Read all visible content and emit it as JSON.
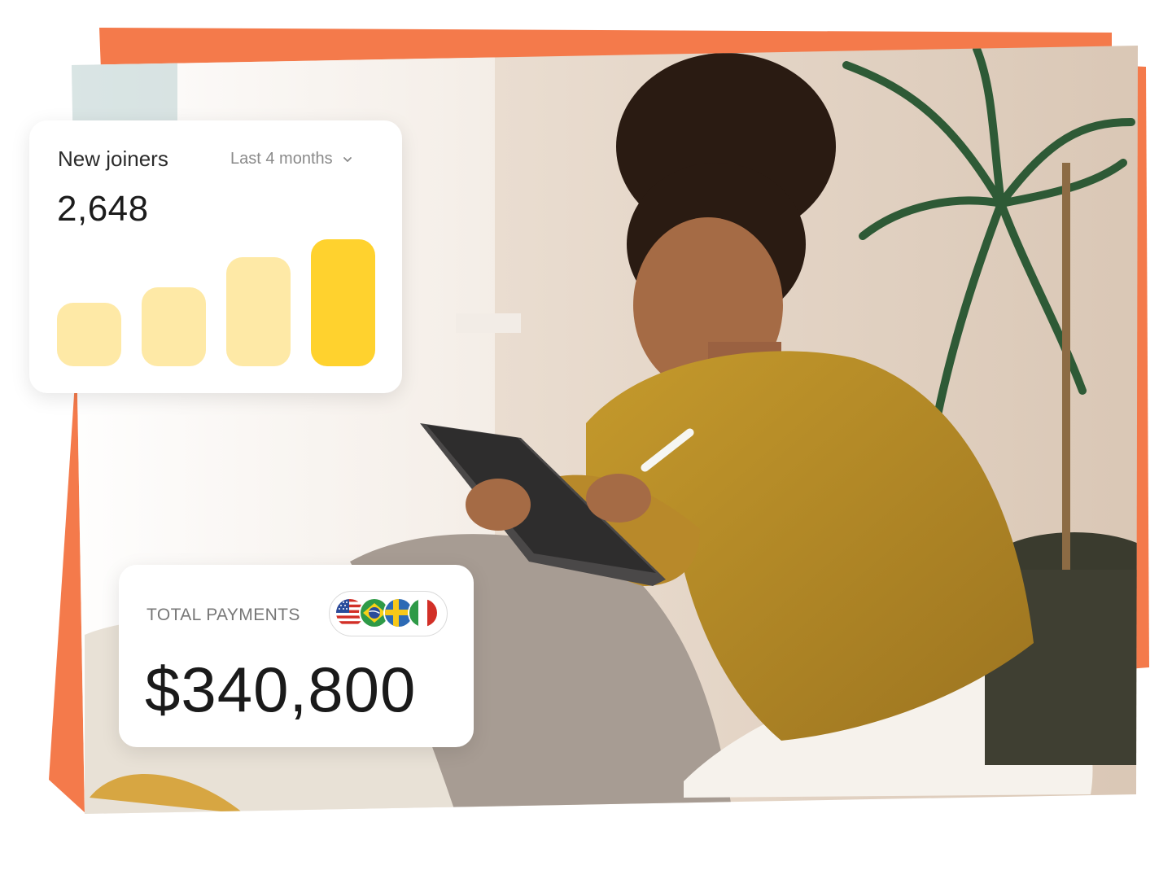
{
  "joiners_card": {
    "title": "New joiners",
    "filter_label": "Last 4 months",
    "value": "2,648",
    "bars": [
      {
        "level": 0.5,
        "color": "#FEE9A6"
      },
      {
        "level": 0.62,
        "color": "#FEE9A6"
      },
      {
        "level": 0.86,
        "color": "#FEE9A6"
      },
      {
        "level": 1.0,
        "color": "#FFD22E"
      }
    ],
    "icons": {
      "filter": "chevron-down-icon"
    }
  },
  "payments_card": {
    "label": "TOTAL PAYMENTS",
    "value": "$340,800",
    "flags": [
      "us-flag-icon",
      "brazil-flag-icon",
      "sweden-flag-icon",
      "italy-flag-icon"
    ]
  },
  "colors": {
    "accent_orange": "#F47A4B",
    "bar_light": "#FEE9A6",
    "bar_highlight": "#FFD22E"
  }
}
